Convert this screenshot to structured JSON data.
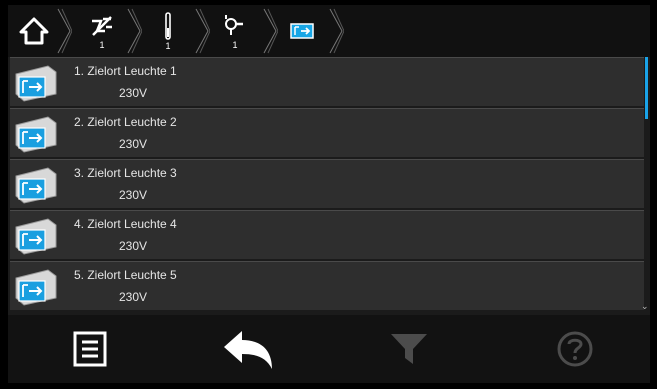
{
  "breadcrumb": {
    "items": [
      {
        "icon": "home-icon",
        "count": ""
      },
      {
        "icon": "circuit-off-icon",
        "count": "1"
      },
      {
        "icon": "circuit-line-icon",
        "count": "1"
      },
      {
        "icon": "lamp-icon",
        "count": "1"
      },
      {
        "icon": "exit-sign-icon",
        "count": ""
      }
    ]
  },
  "list": {
    "items": [
      {
        "name": "1. Zielort Leuchte 1",
        "voltage": "230V"
      },
      {
        "name": "2. Zielort Leuchte 2",
        "voltage": "230V"
      },
      {
        "name": "3. Zielort Leuchte 3",
        "voltage": "230V"
      },
      {
        "name": "4. Zielort Leuchte 4",
        "voltage": "230V"
      },
      {
        "name": "5. Zielort Leuchte 5",
        "voltage": "230V"
      }
    ],
    "item_icon": "exit-sign-icon"
  },
  "toolbar": {
    "buttons": [
      "menu-icon",
      "back-arrow-icon",
      "filter-icon",
      "help-icon"
    ],
    "filter_enabled": false,
    "help_enabled": false
  },
  "colors": {
    "accent": "#1aa3e8",
    "row_bg": "#2e2e2e",
    "background": "#1b1b1b"
  }
}
